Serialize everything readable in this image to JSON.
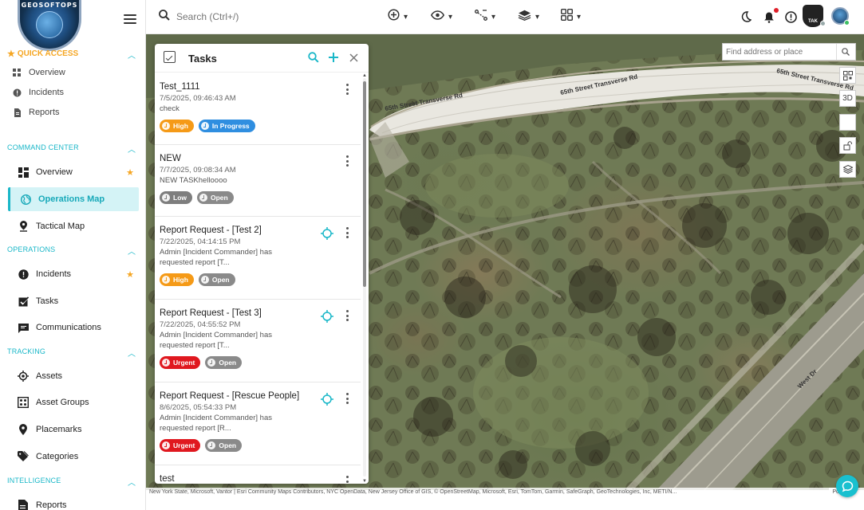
{
  "logo": {
    "text": "GEOSOFTOPS"
  },
  "sidebar": {
    "quick_access": {
      "title": "QUICK ACCESS",
      "items": [
        {
          "label": "Overview",
          "icon": "grid-icon"
        },
        {
          "label": "Incidents",
          "icon": "alert-icon"
        },
        {
          "label": "Reports",
          "icon": "document-icon"
        }
      ]
    },
    "sections": [
      {
        "title": "COMMAND CENTER",
        "items": [
          {
            "label": "Overview",
            "icon": "dashboard-icon",
            "favorite": true
          },
          {
            "label": "Operations Map",
            "icon": "globe-icon",
            "active": true
          },
          {
            "label": "Tactical Map",
            "icon": "map-pin-icon"
          }
        ]
      },
      {
        "title": "OPERATIONS",
        "items": [
          {
            "label": "Incidents",
            "icon": "alert-icon",
            "favorite": true
          },
          {
            "label": "Tasks",
            "icon": "checkbox-icon"
          },
          {
            "label": "Communications",
            "icon": "chat-icon"
          }
        ]
      },
      {
        "title": "TRACKING",
        "items": [
          {
            "label": "Assets",
            "icon": "target-icon"
          },
          {
            "label": "Asset Groups",
            "icon": "group-icon"
          },
          {
            "label": "Placemarks",
            "icon": "placemark-icon"
          },
          {
            "label": "Categories",
            "icon": "tag-icon"
          }
        ]
      },
      {
        "title": "INTELLIGENCE",
        "items": [
          {
            "label": "Reports",
            "icon": "report-icon"
          }
        ]
      }
    ]
  },
  "topbar": {
    "search_placeholder": "Search (Ctrl+/)",
    "tools": [
      "add-location-icon",
      "eye-icon",
      "measure-icon",
      "layers-icon",
      "grid-apps-icon"
    ],
    "org_badge": "TAK"
  },
  "map": {
    "place_search_placeholder": "Find address or place",
    "controls": [
      "qr-icon",
      "3D",
      "blank",
      "lock-icon",
      "layers-icon"
    ],
    "street_labels": [
      "65th Street Transverse Rd",
      "65th Street Transverse Rd",
      "65th Street Transverse Rd",
      "West Dr"
    ],
    "credits": "New York State, Microsoft, Vantor | Esri Community Maps Contributors, NYC OpenData, New Jersey Office of GIS, © OpenStreetMap, Microsoft, Esri, TomTom, Garmin, SafeGraph, GeoTechnologies, Inc, METI/N...",
    "powered": "Powered"
  },
  "tasks_panel": {
    "title": "Tasks",
    "tasks": [
      {
        "title": "Test_1111",
        "date": "7/5/2025, 09:46:43 AM",
        "desc": "check",
        "priority": "High",
        "status": "In Progress",
        "locate": false
      },
      {
        "title": "NEW",
        "date": "7/7/2025, 09:08:34 AM",
        "desc": "NEW TASKhelloooo",
        "priority": "Low",
        "status": "Open",
        "locate": false
      },
      {
        "title": "Report Request - [Test 2]",
        "date": "7/22/2025, 04:14:15 PM",
        "desc": "Admin [Incident Commander] has requested report [T...",
        "priority": "High",
        "status": "Open",
        "locate": true
      },
      {
        "title": "Report Request - [Test 3]",
        "date": "7/22/2025, 04:55:52 PM",
        "desc": "Admin [Incident Commander] has requested report [T...",
        "priority": "Urgent",
        "status": "Open",
        "locate": true
      },
      {
        "title": "Report Request - [Rescue People]",
        "date": "8/6/2025, 05:54:33 PM",
        "desc": "Admin [Incident Commander] has requested report [R...",
        "priority": "Urgent",
        "status": "Open",
        "locate": true
      },
      {
        "title": "test",
        "date": "",
        "desc": "",
        "priority": "",
        "status": "",
        "locate": false
      }
    ]
  },
  "colors": {
    "accent": "#19b7c8",
    "high": "#f59a17",
    "urgent": "#e0181f",
    "low": "#7e7e7e",
    "in_progress": "#2f8ee0",
    "open": "#8a8a8a",
    "favorite": "#f5a623"
  }
}
